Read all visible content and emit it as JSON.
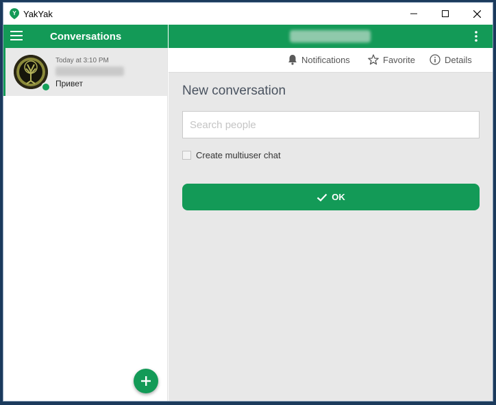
{
  "window": {
    "title": "YakYak"
  },
  "sidebar": {
    "title": "Conversations",
    "conversations": [
      {
        "time": "Today at 3:10 PM",
        "preview": "Привет"
      }
    ]
  },
  "main": {
    "toolbar": {
      "notifications": "Notifications",
      "favorite": "Favorite",
      "details": "Details"
    },
    "new_conversation": {
      "title": "New conversation",
      "search_placeholder": "Search people",
      "multiuser_label": "Create multiuser chat",
      "ok_label": "OK"
    }
  },
  "colors": {
    "accent": "#139a57",
    "background": "#e8e8e8"
  },
  "icons": {
    "menu": "hamburger-menu-icon",
    "more": "vertical-dots-icon",
    "bell": "bell-icon",
    "star": "star-icon",
    "info": "info-icon",
    "check": "check-icon",
    "plus": "plus-icon"
  }
}
